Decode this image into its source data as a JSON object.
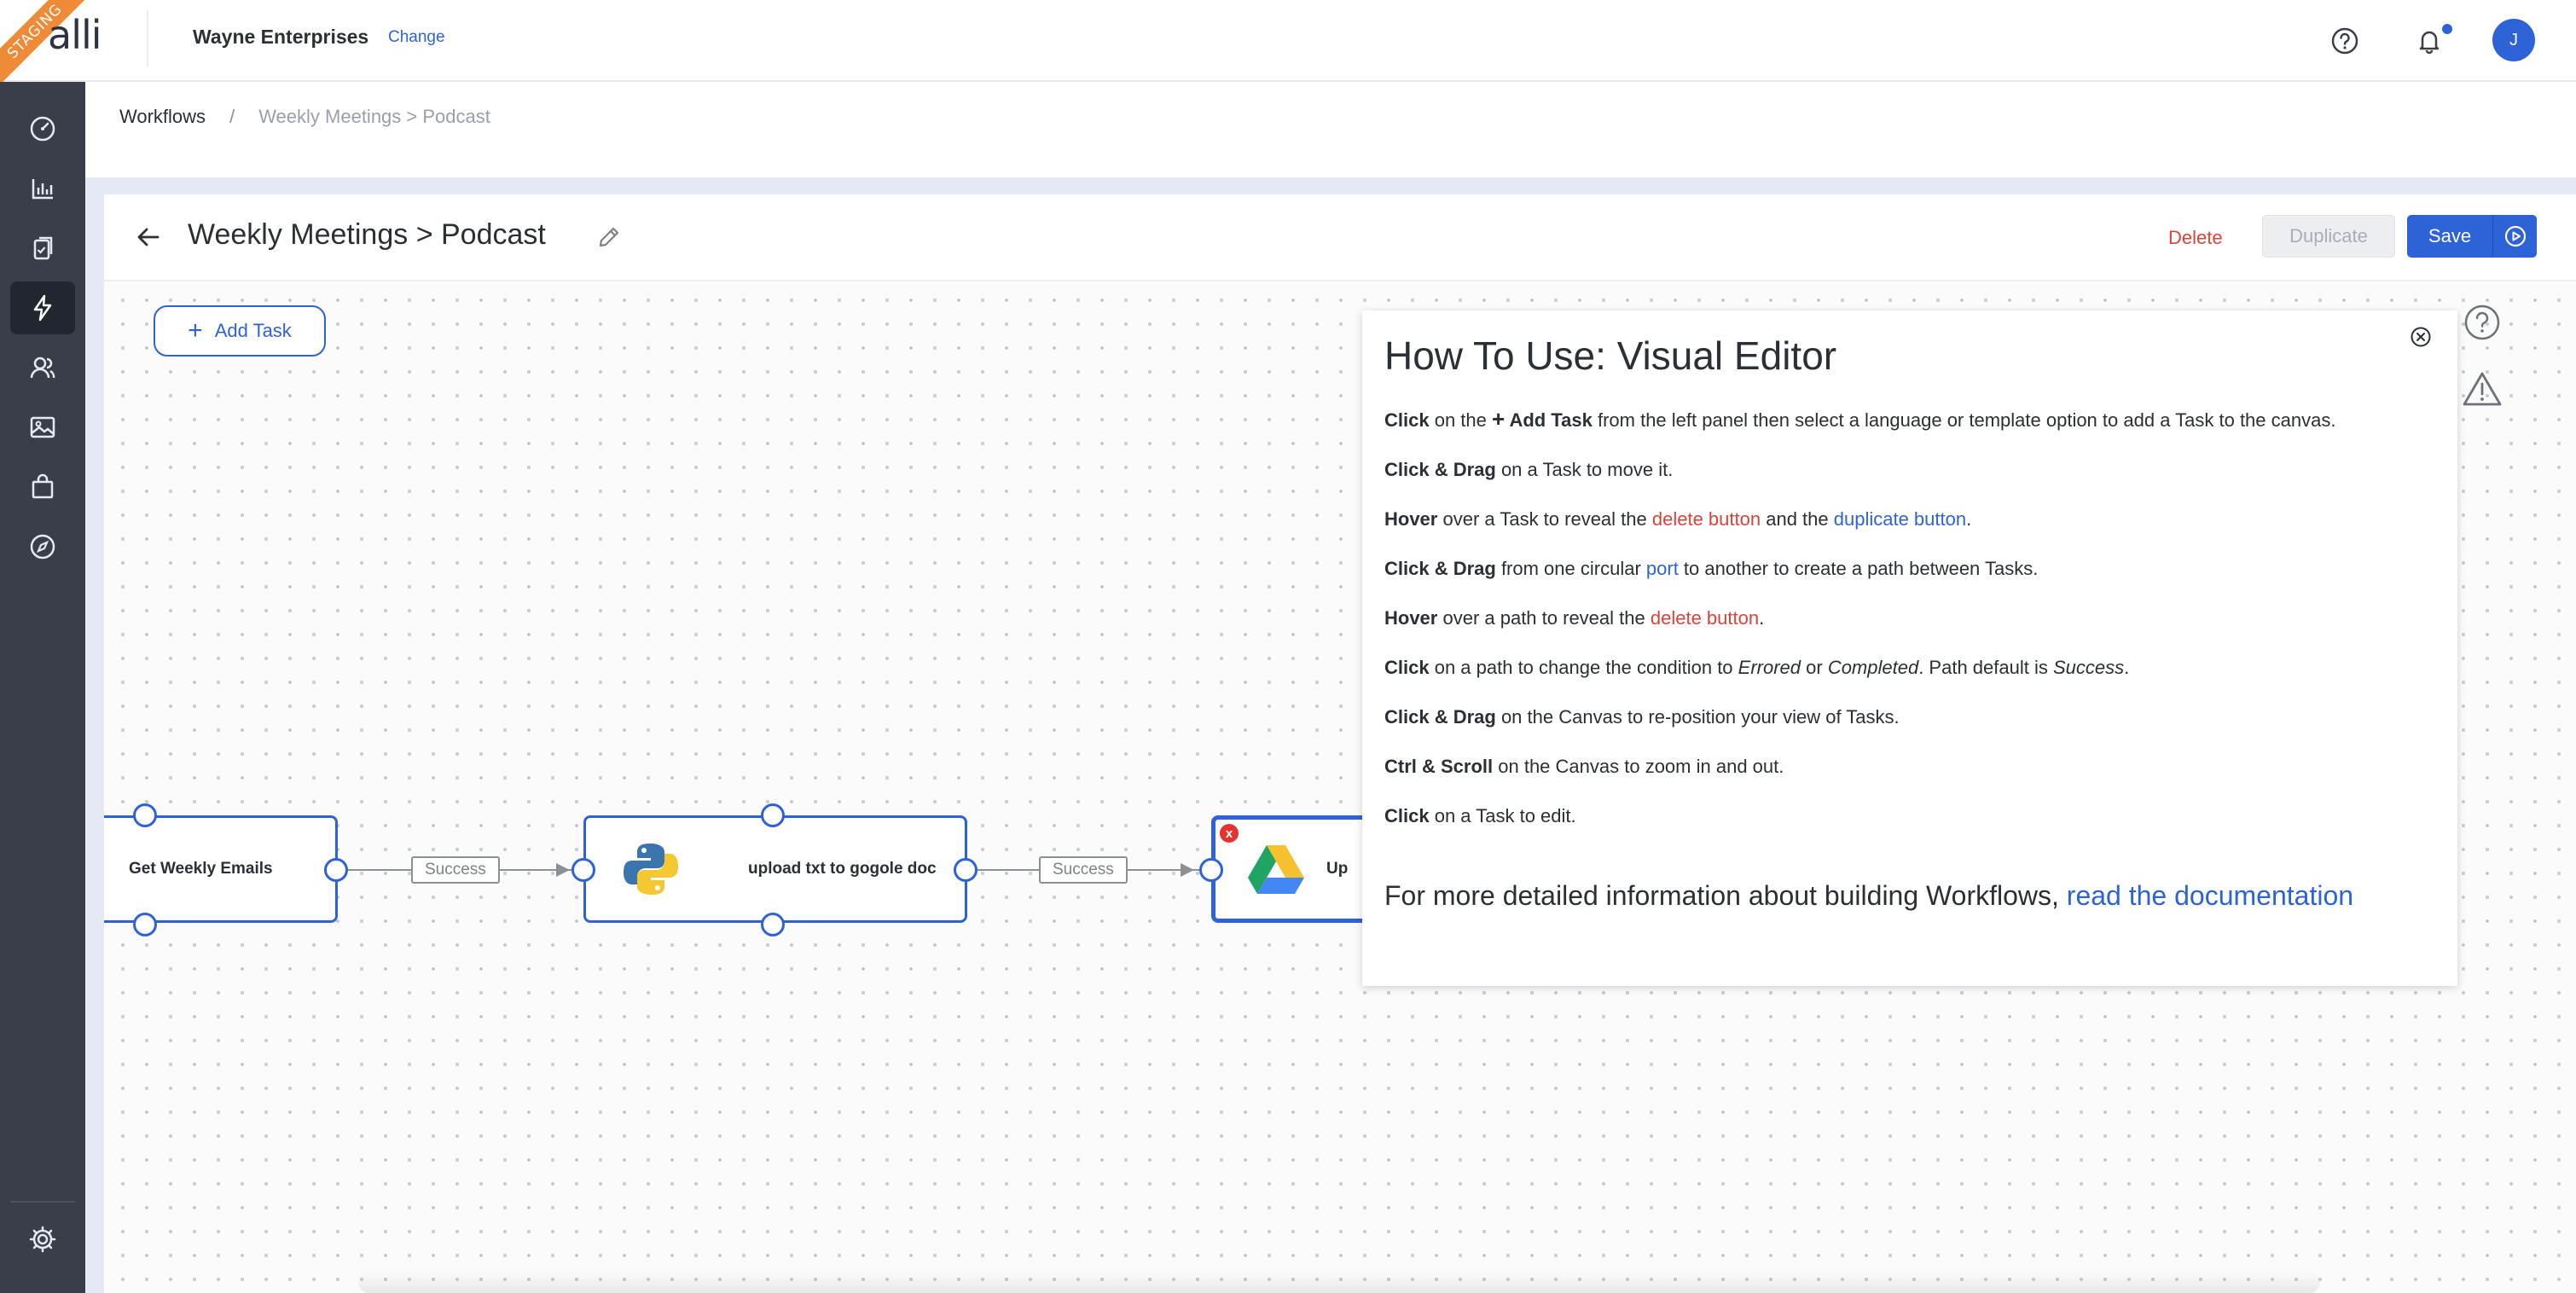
{
  "app": {
    "staging_label": "STAGING",
    "logo_text": "alli",
    "org_name": "Wayne Enterprises",
    "org_change": "Change",
    "avatar_initial": "J"
  },
  "icons": {
    "top": [
      "help-circle-icon",
      "bell-icon"
    ],
    "sidebar": [
      "dashboard-icon",
      "bar-chart-icon",
      "clipboard-icon",
      "lightning-icon",
      "users-icon",
      "image-icon",
      "shopping-bag-icon",
      "compass-icon",
      "settings-icon"
    ]
  },
  "colors": {
    "accent": "#2e63d8",
    "danger": "#d9443a",
    "sidebar": "#393e4a",
    "staging": "#ef8a36"
  },
  "breadcrumb": {
    "root": "Workflows",
    "separator": "/",
    "current": "Weekly Meetings > Podcast"
  },
  "header": {
    "title": "Weekly Meetings > Podcast",
    "delete": "Delete",
    "duplicate": "Duplicate",
    "save": "Save"
  },
  "canvas": {
    "add_task": "Add Task",
    "tasks": [
      {
        "label": "Get Weekly Emails",
        "icon": null
      },
      {
        "label": "upload txt to gogole doc",
        "icon": "python-logo-icon"
      },
      {
        "label": "Up",
        "icon": "google-drive-icon",
        "error_badge": "x"
      }
    ],
    "edges": [
      "Success",
      "Success"
    ]
  },
  "help": {
    "title": "How To Use: Visual Editor",
    "l1_b": "Click",
    "l1_a": " on the ",
    "l1_plus": "+",
    "l1_c": " Add Task",
    "l1_d": " from the left panel then select a language or template option to add a Task to the canvas.",
    "l2_b": "Click & Drag",
    "l2_a": " on a Task to move it.",
    "l3_b": "Hover",
    "l3_a": " over a Task to reveal the ",
    "l3_r": "delete button",
    "l3_m": " and the ",
    "l3_bl": "duplicate button",
    "l3_e": ".",
    "l4_b": "Click & Drag",
    "l4_a": " from one circular ",
    "l4_bl": "port",
    "l4_e": " to another to create a path between Tasks.",
    "l5_b": "Hover",
    "l5_a": " over a path to reveal the ",
    "l5_r": "delete button",
    "l5_e": ".",
    "l6_b": "Click",
    "l6_a": " on a path to change the condition to ",
    "l6_i1": "Errored",
    "l6_m": " or ",
    "l6_i2": "Completed",
    "l6_n": ". Path default is ",
    "l6_i3": "Success",
    "l6_e": ".",
    "l7_b": "Click & Drag",
    "l7_a": " on the Canvas to re-position your view of Tasks.",
    "l8_b": "Ctrl & Scroll",
    "l8_a": " on the Canvas to zoom in and out.",
    "l9_b": "Click",
    "l9_a": " on a Task to edit.",
    "footer_text": "For more detailed information about building Workflows, ",
    "footer_link": "read the documentation"
  }
}
